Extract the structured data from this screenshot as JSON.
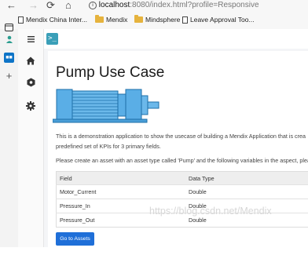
{
  "browser": {
    "url_host": "localhost",
    "url_path": ":8080/index.html?profile=Responsive",
    "bookmarks": [
      {
        "label": "Mendix China Inter...",
        "icon": "page-icon"
      },
      {
        "label": "Mendix",
        "icon": "folder-icon"
      },
      {
        "label": "Mindsphere",
        "icon": "folder-icon"
      },
      {
        "label": "Leave Approval Too...",
        "icon": "page-icon"
      }
    ]
  },
  "app": {
    "title": "Pump Use Case",
    "description_line1": "This is a demonstration application to show the usecase of building a Mendix Application that is crea",
    "description_line2": "predefined set of KPIs for 3 primary fields.",
    "instruction": "Please create an asset with an asset type called 'Pump' and the following variables in the aspect, plea",
    "table": {
      "headers": [
        "Field",
        "Data Type"
      ],
      "rows": [
        [
          "Motor_Current",
          "Double"
        ],
        [
          "Pressure_In",
          "Double"
        ],
        [
          "Pressure_Out",
          "Double"
        ]
      ]
    },
    "button_label": "Go to Assets"
  },
  "watermark": "https://blog.csdn.net/Mendix",
  "colors": {
    "accent": "#1f6fd8",
    "pump_blue": "#5aaee6",
    "logo": "#3a9fb8"
  }
}
